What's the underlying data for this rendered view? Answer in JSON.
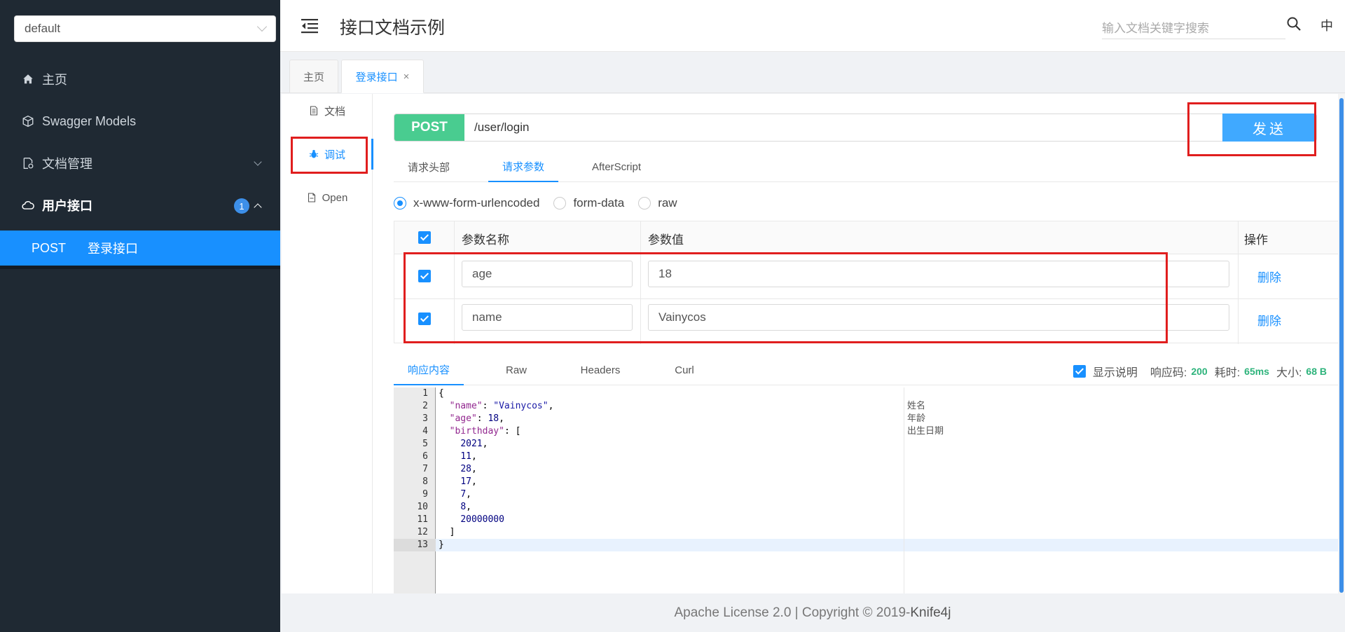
{
  "sidebar": {
    "group_select": "default",
    "items": [
      {
        "label": "主页",
        "icon": "home-icon"
      },
      {
        "label": "Swagger Models",
        "icon": "cube-icon"
      },
      {
        "label": "文档管理",
        "icon": "doc-settings-icon"
      },
      {
        "label": "用户接口",
        "icon": "cloud-icon",
        "badge": "1"
      }
    ],
    "submenu": {
      "method": "POST",
      "label": "登录接口"
    }
  },
  "header": {
    "title": "接口文档示例",
    "search_placeholder": "输入文档关键字搜索",
    "lang": "中"
  },
  "tabs": [
    {
      "label": "主页"
    },
    {
      "label": "登录接口",
      "close": "×"
    }
  ],
  "side_nav": [
    {
      "label": "文档"
    },
    {
      "label": "调试"
    },
    {
      "label": "Open"
    }
  ],
  "request": {
    "method": "POST",
    "url": "/user/login",
    "send_label": "发送",
    "tabs": [
      "请求头部",
      "请求参数",
      "AfterScript"
    ],
    "content_types": [
      "x-www-form-urlencoded",
      "form-data",
      "raw"
    ]
  },
  "params": {
    "headers": {
      "name": "参数名称",
      "value": "参数值",
      "action": "操作"
    },
    "rows": [
      {
        "name": "age",
        "value": "18",
        "action": "删除"
      },
      {
        "name": "name",
        "value": "Vainycos",
        "action": "删除"
      }
    ]
  },
  "response": {
    "tabs": [
      "响应内容",
      "Raw",
      "Headers",
      "Curl"
    ],
    "show_desc_label": "显示说明",
    "code_label": "响应码:",
    "code_value": "200",
    "time_label": "耗时:",
    "time_value": "65ms",
    "size_label": "大小:",
    "size_value": "68 B",
    "line_numbers": [
      "1",
      "2",
      "3",
      "4",
      "5",
      "6",
      "7",
      "8",
      "9",
      "10",
      "11",
      "12",
      "13"
    ],
    "descriptions": [
      "姓名",
      "年龄",
      "出生日期"
    ]
  },
  "footer": {
    "text": "Apache License 2.0 | Copyright © 2019-",
    "brand": "Knife4j"
  }
}
